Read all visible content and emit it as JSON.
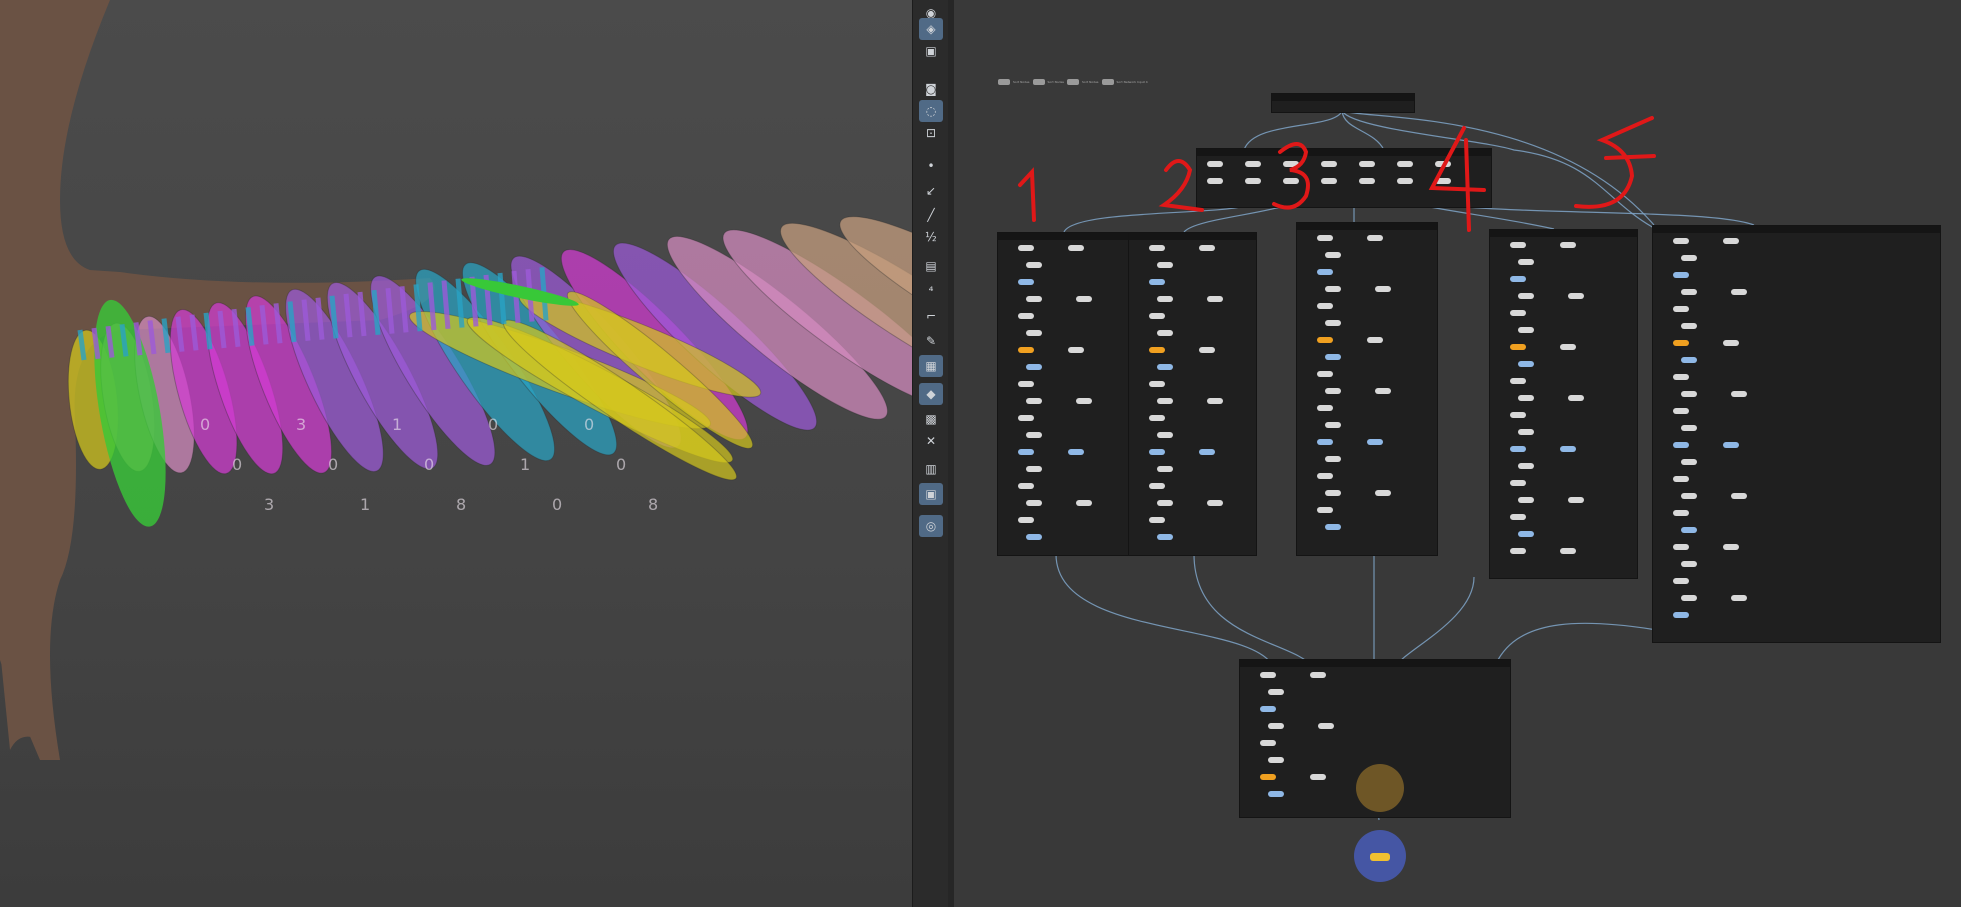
{
  "annotations": [
    "1",
    "2",
    "3",
    "4",
    "5"
  ],
  "hotkey_hints": [
    "Sort Nodes",
    "Sort Nodes",
    "Sort Nodes",
    "Sort Network Input 4"
  ],
  "colors": {
    "annotation_red": "#e01818",
    "wire_blue": "#7fa4c8",
    "node_blue": "#8fb8e6",
    "node_orange": "#f0a020",
    "node_pink": "#e06ab8",
    "feather_yellow": "#d4c81c",
    "feather_magenta": "#d23cd2",
    "feather_violet": "#9c5ad8",
    "feather_cyan": "#29a3c4",
    "feather_green": "#38c838",
    "feather_pink": "#d68cc0",
    "feather_tan": "#c8a080"
  },
  "toolbar_icons": [
    "select-icon",
    "view-icon",
    "camera-icon",
    "display-icon",
    "lights-icon",
    "render-icon",
    "point-icon",
    "brush-icon",
    "pen-icon",
    "measure-icon",
    "sculpt-icon",
    "numeric-icon",
    "edge-icon",
    "draw-curve-icon",
    "cube-icon",
    "snap-icon",
    "texture-icon",
    "handle-icon",
    "transform-icon",
    "viewer-icon",
    "pin-icon"
  ],
  "feather_rings": [
    "0",
    "0",
    "3",
    "3",
    "0",
    "1",
    "1",
    "0",
    "8",
    "0",
    "1",
    "0",
    "0",
    "0",
    "8"
  ]
}
